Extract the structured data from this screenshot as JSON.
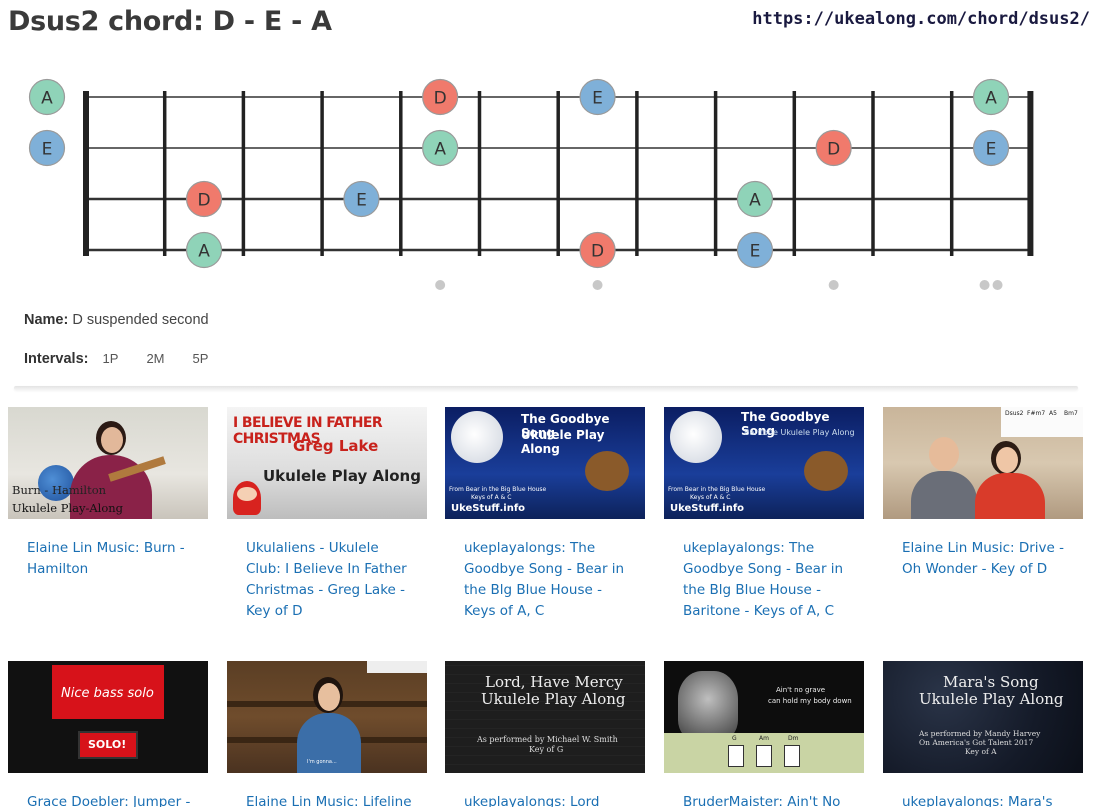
{
  "page": {
    "title": "Dsus2 chord: D - E - A",
    "url": "https://ukealong.com/chord/dsus2/"
  },
  "fretboard": {
    "colors": {
      "A": "#8fd3b8",
      "D": "#f07a6c",
      "E": "#7fb0d8"
    },
    "strings": 4,
    "frets": 12,
    "open_notes": [
      {
        "string": 0,
        "note": "A"
      },
      {
        "string": 1,
        "note": "E"
      }
    ],
    "notes": [
      {
        "string": 0,
        "fret": 5,
        "note": "D"
      },
      {
        "string": 0,
        "fret": 7,
        "note": "E"
      },
      {
        "string": 0,
        "fret": 12,
        "note": "A"
      },
      {
        "string": 1,
        "fret": 5,
        "note": "A"
      },
      {
        "string": 1,
        "fret": 10,
        "note": "D"
      },
      {
        "string": 1,
        "fret": 12,
        "note": "E"
      },
      {
        "string": 2,
        "fret": 2,
        "note": "D"
      },
      {
        "string": 2,
        "fret": 4,
        "note": "E"
      },
      {
        "string": 2,
        "fret": 9,
        "note": "A"
      },
      {
        "string": 3,
        "fret": 2,
        "note": "A"
      },
      {
        "string": 3,
        "fret": 7,
        "note": "D"
      },
      {
        "string": 3,
        "fret": 9,
        "note": "E"
      }
    ],
    "marker_frets": [
      5,
      7,
      10,
      12
    ],
    "double_marker_frets": [
      12
    ]
  },
  "info": {
    "name_label": "Name:",
    "name_value": "D suspended second",
    "intervals_label": "Intervals:",
    "intervals": [
      "1P",
      "2M",
      "5P"
    ]
  },
  "videos": [
    {
      "title": "Elaine Lin Music: Burn - Hamilton",
      "thumb_lines": [
        "Burn - Hamilton",
        "Ukulele Play-Along"
      ]
    },
    {
      "title": "Ukulaliens - Ukulele Club: I Believe In Father Christmas - Greg Lake - Key of D",
      "thumb_lines": [
        "I BELIEVE IN FATHER CHRISTMAS",
        "Greg Lake",
        "Ukulele Play Along"
      ]
    },
    {
      "title": "ukeplayalongs: The Goodbye Song - Bear in the Blg Blue House - Keys of A, C",
      "thumb_lines": [
        "The Goodbye Song",
        "Ukulele Play Along",
        "From Bear in the Big Blue House",
        "Keys of A & C",
        "UkeStuff.info"
      ]
    },
    {
      "title": "ukeplayalongs: The Goodbye Song - Bear in the Blg Blue House - Baritone - Keys of A, C",
      "thumb_lines": [
        "The Goodbye Song",
        "Baritone Ukulele Play Along",
        "From Bear in the Big Blue House",
        "Keys of A & C",
        "UkeStuff.info"
      ]
    },
    {
      "title": "Elaine Lin Music: Drive - Oh Wonder - Key of D",
      "thumb_lines": [
        "Dsus2",
        "F#m7",
        "A5",
        "Bm7"
      ]
    },
    {
      "title": "Grace Doebler: Jumper -",
      "thumb_lines": [
        "Nice bass solo",
        "SOLO!"
      ]
    },
    {
      "title": "Elaine Lin Music: Lifeline",
      "thumb_lines": [
        "I'm gonna..."
      ]
    },
    {
      "title": "ukeplayalongs: Lord",
      "thumb_lines": [
        "Lord, Have Mercy",
        "Ukulele Play Along",
        "As performed by Michael W. Smith",
        "Key of G"
      ]
    },
    {
      "title": "BruderMaister: Ain't No",
      "thumb_lines": [
        "Ain't no grave",
        "can hold my body down",
        "G",
        "Am",
        "Dm"
      ]
    },
    {
      "title": "ukeplayalongs: Mara's",
      "thumb_lines": [
        "Mara's Song",
        "Ukulele Play Along",
        "As performed by Mandy Harvey",
        "On America's Got Talent 2017",
        "Key of A"
      ]
    }
  ]
}
